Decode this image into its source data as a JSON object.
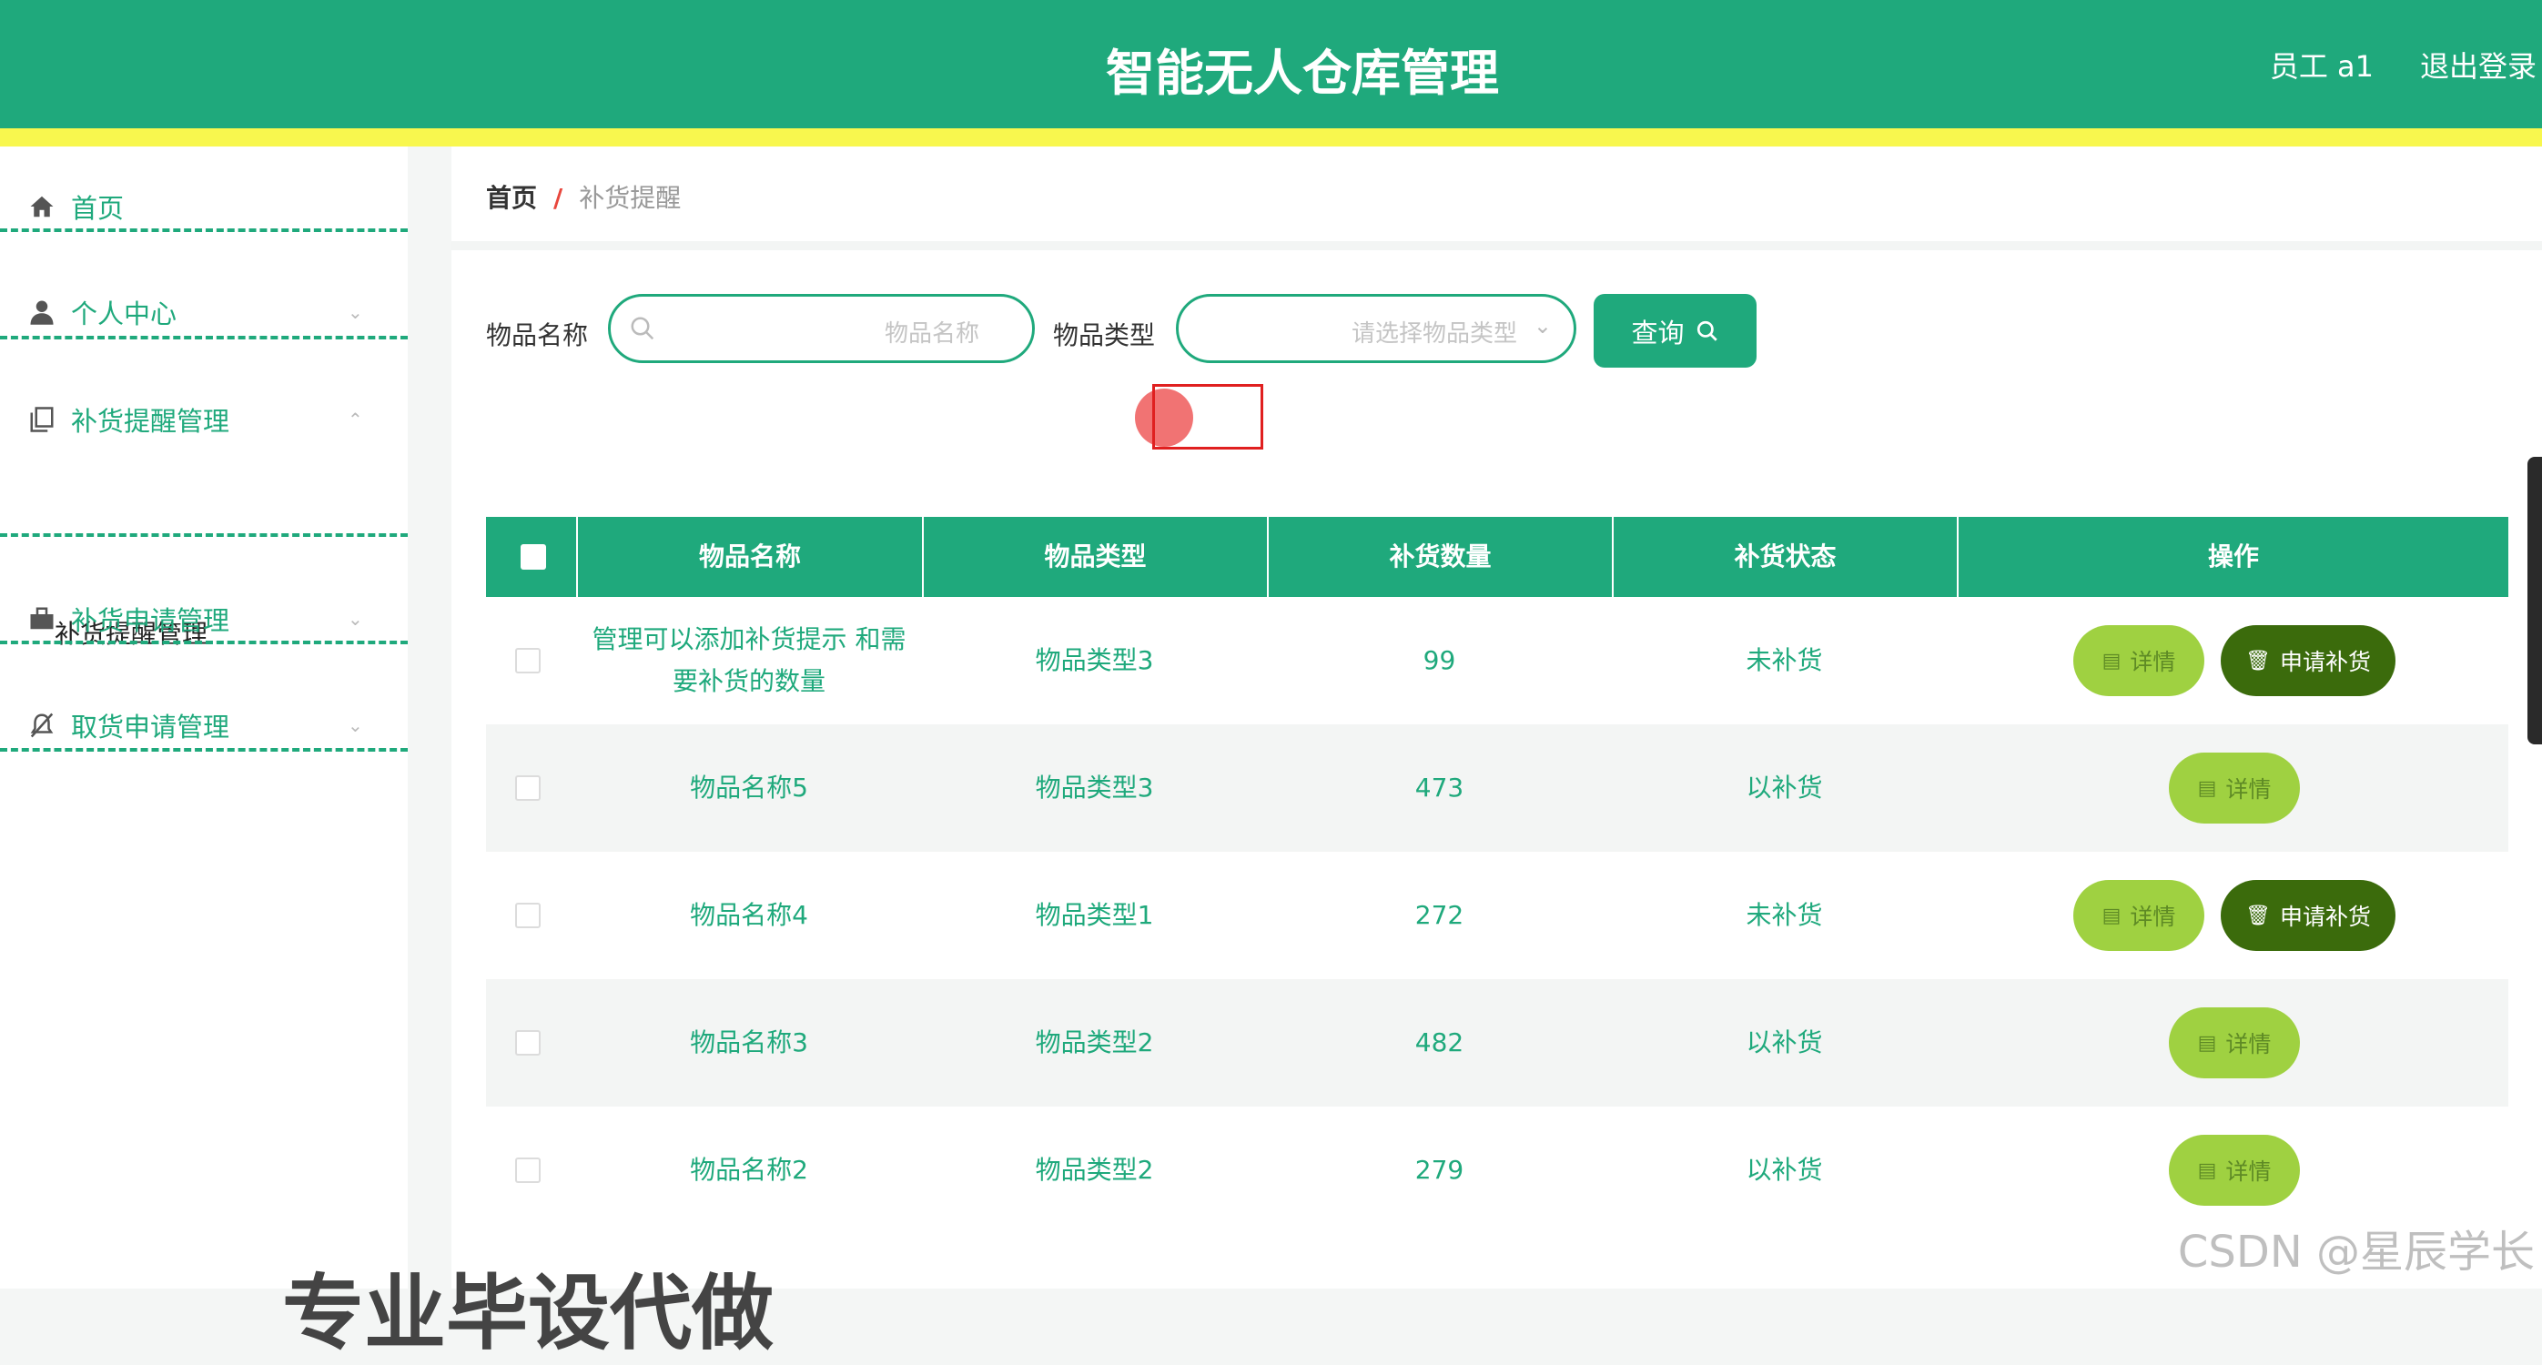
{
  "header": {
    "title": "智能无人仓库管理",
    "user": "员工 a1",
    "logout": "退出登录"
  },
  "sidebar": {
    "items": [
      {
        "label": "首页",
        "icon": "home-icon"
      },
      {
        "label": "个人中心",
        "icon": "user-icon"
      },
      {
        "label": "补货提醒管理",
        "icon": "copy-icon"
      },
      {
        "label": "补货申请管理",
        "icon": "briefcase-icon"
      },
      {
        "label": "取货申请管理",
        "icon": "bell-off-icon"
      }
    ],
    "submenu": "补货提醒管理"
  },
  "breadcrumb": {
    "home": "首页",
    "sep": "/",
    "current": "补货提醒"
  },
  "search": {
    "name_label": "物品名称",
    "name_placeholder": "物品名称",
    "type_label": "物品类型",
    "type_placeholder": "请选择物品类型",
    "button": "查询"
  },
  "table": {
    "headers": [
      "物品名称",
      "物品类型",
      "补货数量",
      "补货状态",
      "操作"
    ],
    "detail_label": "详情",
    "apply_label": "申请补货",
    "rows": [
      {
        "name": "管理可以添加补货提示 和需要补货的数量",
        "type": "物品类型3",
        "qty": "99",
        "status": "未补货",
        "can_apply": true
      },
      {
        "name": "物品名称5",
        "type": "物品类型3",
        "qty": "473",
        "status": "以补货",
        "can_apply": false
      },
      {
        "name": "物品名称4",
        "type": "物品类型1",
        "qty": "272",
        "status": "未补货",
        "can_apply": true
      },
      {
        "name": "物品名称3",
        "type": "物品类型2",
        "qty": "482",
        "status": "以补货",
        "can_apply": false
      },
      {
        "name": "物品名称2",
        "type": "物品类型2",
        "qty": "279",
        "status": "以补货",
        "can_apply": false
      }
    ]
  },
  "watermark": "CSDN @星辰学长",
  "overlay": "专业毕设代做",
  "colors": {
    "primary": "#1fa97c",
    "accent_bar": "#f8f74e",
    "detail_btn": "#9fd141",
    "apply_btn": "#3b6b0c"
  }
}
